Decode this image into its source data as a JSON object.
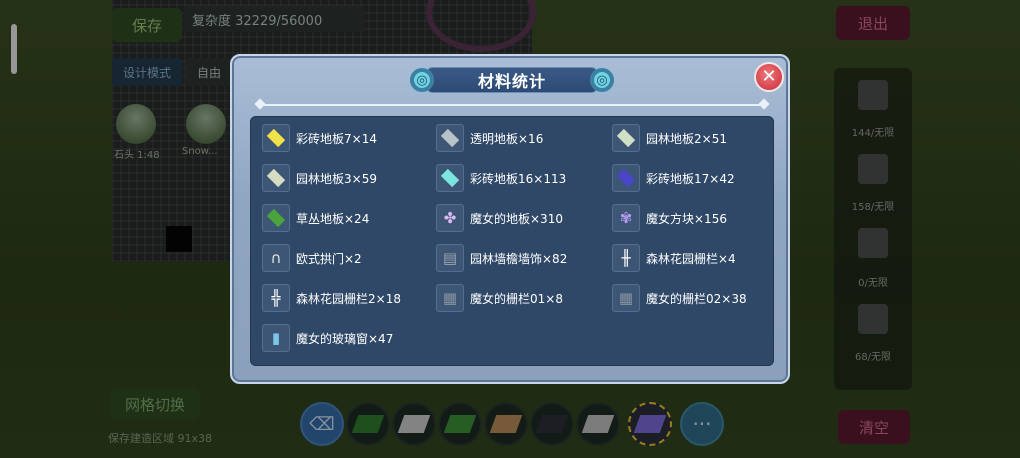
{
  "background": {
    "save_button": "保存",
    "counter": "复杂度 32229/56000",
    "design_mode": "设计模式",
    "free_mode": "自由",
    "exit_button": "退出",
    "clear_button": "清空",
    "grid_toggle": "网格切换",
    "hint_text": "保存建造区域 91x38",
    "ball_labels": [
      "石头 1:48",
      "Snow..."
    ],
    "right_panel": [
      {
        "icon": "floor-icon",
        "label": "144/无限"
      },
      {
        "icon": "grid-icon",
        "label": "158/无限"
      },
      {
        "icon": "phone-icon",
        "label": "0/无限"
      },
      {
        "icon": "fence-icon",
        "label": "68/无限"
      }
    ]
  },
  "dialog": {
    "title": "材料统计",
    "close_label": "✕",
    "items": [
      {
        "label": "彩砖地板7×14",
        "icon": "yellow-floor-icon",
        "color": "#f2e24a"
      },
      {
        "label": "透明地板×16",
        "icon": "transparent-floor-icon",
        "color": "#b8c2c9"
      },
      {
        "label": "园林地板2×51",
        "icon": "garden-floor-icon",
        "color": "#cfe0c4"
      },
      {
        "label": "园林地板3×59",
        "icon": "garden-floor-icon",
        "color": "#d6dcc2"
      },
      {
        "label": "彩砖地板16×113",
        "icon": "cyan-floor-icon",
        "color": "#7fe3e0"
      },
      {
        "label": "彩砖地板17×42",
        "icon": "blue-floor-icon",
        "color": "#4a45c9"
      },
      {
        "label": "草丛地板×24",
        "icon": "grass-floor-icon",
        "color": "#4aa33c"
      },
      {
        "label": "魔女的地板×310",
        "icon": "witch-floor-icon",
        "color": "#d8b8f0"
      },
      {
        "label": "魔女方块×156",
        "icon": "witch-block-icon",
        "color": "#b89cf0"
      },
      {
        "label": "欧式拱门×2",
        "icon": "arch-door-icon",
        "color": "#e6e6e6"
      },
      {
        "label": "园林墙檐墙饰×82",
        "icon": "eave-icon",
        "color": "#6c7a86"
      },
      {
        "label": "森林花园栅栏×4",
        "icon": "fence-icon",
        "color": "#ffffff"
      },
      {
        "label": "森林花园栅栏2×18",
        "icon": "fence-icon",
        "color": "#ffffff"
      },
      {
        "label": "魔女的栅栏01×8",
        "icon": "witch-fence-icon",
        "color": "#5a6470"
      },
      {
        "label": "魔女的栅栏02×38",
        "icon": "witch-fence-icon",
        "color": "#5a6470"
      },
      {
        "label": "魔女的玻璃窗×47",
        "icon": "glass-window-icon",
        "color": "#7ec6e8"
      }
    ]
  },
  "hotbar": [
    {
      "icon": "eraser-icon"
    },
    {
      "icon": "grass-block-icon"
    },
    {
      "icon": "stone-floor-icon"
    },
    {
      "icon": "grass-block-icon"
    },
    {
      "icon": "wood-floor-icon"
    },
    {
      "icon": "dark-block-icon"
    },
    {
      "icon": "stone-floor-icon"
    },
    {
      "icon": "witch-block-icon"
    },
    {
      "icon": "more-icon",
      "label": "···"
    }
  ]
}
